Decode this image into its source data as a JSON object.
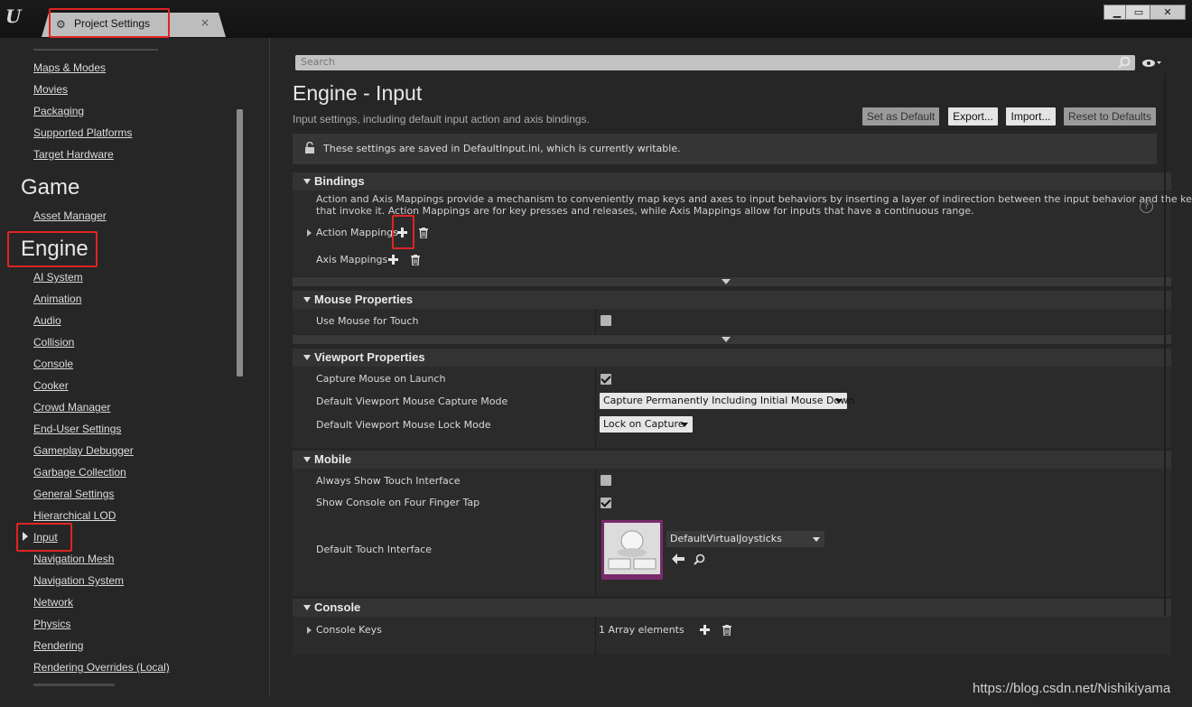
{
  "window": {
    "tab_label": "Project Settings",
    "tab_close": "×",
    "controls": [
      "▁",
      "▭",
      "✕"
    ]
  },
  "sidebar": {
    "group1_items": [
      "Maps & Modes",
      "Movies",
      "Packaging",
      "Supported Platforms",
      "Target Hardware"
    ],
    "game_heading": "Game",
    "game_items": [
      "Asset Manager"
    ],
    "engine_heading": "Engine",
    "engine_items": [
      "AI System",
      "Animation",
      "Audio",
      "Collision",
      "Console",
      "Cooker",
      "Crowd Manager",
      "End-User Settings",
      "Gameplay Debugger",
      "Garbage Collection",
      "General Settings",
      "Hierarchical LOD",
      "Input",
      "Navigation Mesh",
      "Navigation System",
      "Network",
      "Physics",
      "Rendering",
      "Rendering Overrides (Local)"
    ],
    "selected": "Input"
  },
  "search": {
    "placeholder": "Search"
  },
  "header": {
    "title": "Engine - Input",
    "subtitle": "Input settings, including default input action and axis bindings.",
    "buttons": {
      "set_default": "Set as Default",
      "export": "Export...",
      "import": "Import...",
      "reset": "Reset to Defaults"
    },
    "notice": "These settings are saved in DefaultInput.ini, which is currently writable."
  },
  "bindings": {
    "title": "Bindings",
    "description_line1": "Action and Axis Mappings provide a mechanism to conveniently map keys and axes to input behaviors by inserting a layer of indirection between the input behavior and the keys",
    "description_line2": "that invoke it. Action Mappings are for key presses and releases, while Axis Mappings allow for inputs that have a continuous range.",
    "action_mappings": "Action Mappings",
    "axis_mappings": "Axis Mappings"
  },
  "mouse": {
    "title": "Mouse Properties",
    "use_mouse_for_touch": {
      "label": "Use Mouse for Touch",
      "checked": false
    }
  },
  "viewport": {
    "title": "Viewport Properties",
    "capture_on_launch": {
      "label": "Capture Mouse on Launch",
      "checked": true
    },
    "capture_mode": {
      "label": "Default Viewport Mouse Capture Mode",
      "value": "Capture Permanently Including Initial Mouse Down"
    },
    "lock_mode": {
      "label": "Default Viewport Mouse Lock Mode",
      "value": "Lock on Capture"
    }
  },
  "mobile": {
    "title": "Mobile",
    "always_show_touch": {
      "label": "Always Show Touch Interface",
      "checked": false
    },
    "console_four_finger": {
      "label": "Show Console on Four Finger Tap",
      "checked": true
    },
    "default_touch": {
      "label": "Default Touch Interface",
      "value": "DefaultVirtualJoysticks"
    }
  },
  "console": {
    "title": "Console",
    "console_keys": {
      "label": "Console Keys",
      "value": "1 Array elements"
    }
  },
  "watermark": "https://blog.csdn.net/Nishikiyama"
}
